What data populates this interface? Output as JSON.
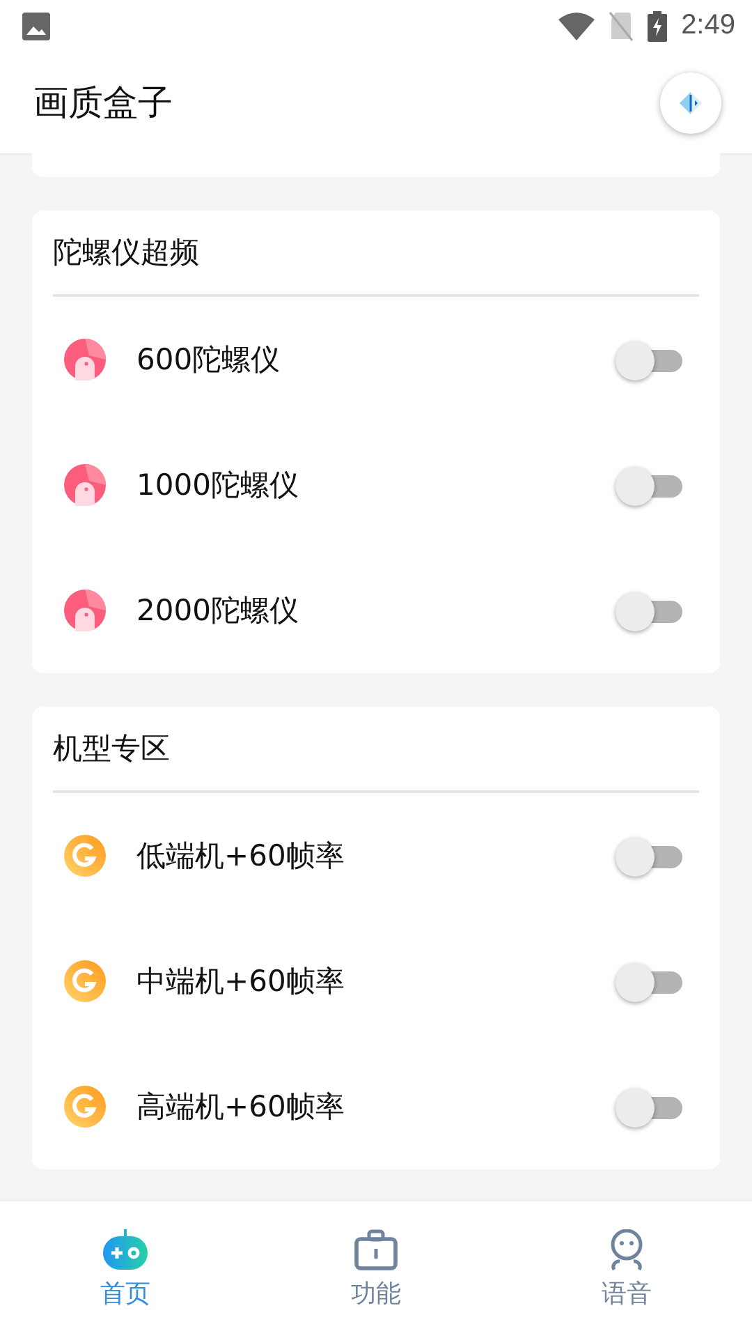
{
  "status_bar": {
    "time": "2:49"
  },
  "app_bar": {
    "title": "画质盒子"
  },
  "sections": [
    {
      "title": "陀螺仪超频",
      "items": [
        {
          "label": "600陀螺仪",
          "kind": "gyro",
          "on": false
        },
        {
          "label": "1000陀螺仪",
          "kind": "gyro",
          "on": false
        },
        {
          "label": "2000陀螺仪",
          "kind": "gyro",
          "on": false
        }
      ]
    },
    {
      "title": "机型专区",
      "items": [
        {
          "label": "低端机+60帧率",
          "kind": "device",
          "on": false
        },
        {
          "label": "中端机+60帧率",
          "kind": "device",
          "on": false
        },
        {
          "label": "高端机+60帧率",
          "kind": "device",
          "on": false
        }
      ]
    }
  ],
  "bottom_nav": [
    {
      "label": "首页",
      "kind": "home",
      "selected": true
    },
    {
      "label": "功能",
      "kind": "tools",
      "selected": false
    },
    {
      "label": "语音",
      "kind": "voice",
      "selected": false
    }
  ]
}
